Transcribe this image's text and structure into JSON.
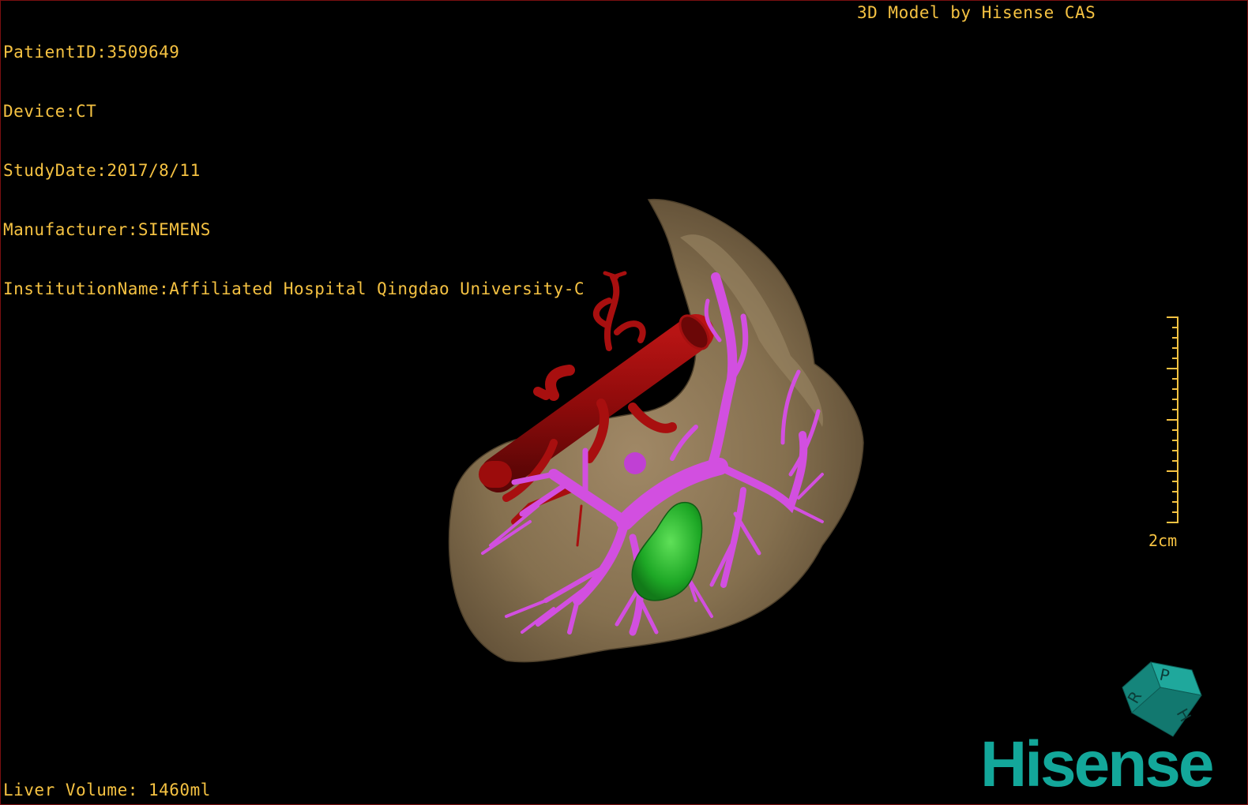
{
  "patient_info": {
    "patient_id": "PatientID:3509649",
    "device": "Device:CT",
    "study_date": "StudyDate:2017/8/11",
    "manufacturer": "Manufacturer:SIEMENS",
    "institution": "InstitutionName:Affiliated Hospital Qingdao University-C"
  },
  "model_credit": "3D Model by Hisense CAS",
  "liver_volume": "Liver Volume: 1460ml",
  "scale": {
    "label": "2cm"
  },
  "orientation_cube": {
    "faces": [
      "P",
      "H",
      "R"
    ]
  },
  "brand": {
    "logo_text": "Hisense"
  },
  "colors": {
    "overlay_text": "#f5c242",
    "liver": "#8a7355",
    "vessel_red": "#9c0c0c",
    "portal_vein": "#d24fe0",
    "tumor": "#1fb32a",
    "logo": "#13a79a",
    "viewport_border": "#7a0f10"
  }
}
